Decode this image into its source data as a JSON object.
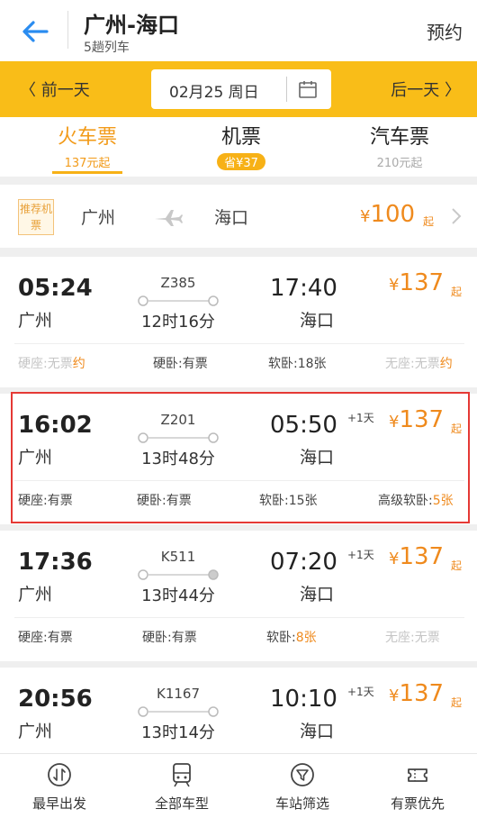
{
  "header": {
    "title": "广州-海口",
    "subtitle": "5趟列车",
    "reserve": "预约"
  },
  "datebar": {
    "prev": "前一天",
    "date": "02月25 周日",
    "next": "后一天"
  },
  "tabs": [
    {
      "label": "火车票",
      "sub": "137元起"
    },
    {
      "label": "机票",
      "sub": "省¥37"
    },
    {
      "label": "汽车票",
      "sub": "210元起"
    }
  ],
  "flight": {
    "tag": "推荐机票",
    "from": "广州",
    "to": "海口",
    "price_symbol": "¥",
    "price": "100",
    "qi": "起"
  },
  "trains": [
    {
      "dep_time": "05:24",
      "dep_station": "广州",
      "number": "Z385",
      "duration": "12时16分",
      "arr_time": "17:40",
      "arr_station": "海口",
      "plus_day": "",
      "price_symbol": "¥",
      "price": "137",
      "qi": "起",
      "seats": [
        {
          "label": "硬座:",
          "value": "无票",
          "extra": "约"
        },
        {
          "label": "硬卧:",
          "value": "有票",
          "extra": ""
        },
        {
          "label": "软卧:",
          "value": "18张",
          "extra": ""
        },
        {
          "label": "无座:",
          "value": "无票",
          "extra": "约"
        }
      ]
    },
    {
      "dep_time": "16:02",
      "dep_station": "广州",
      "number": "Z201",
      "duration": "13时48分",
      "arr_time": "05:50",
      "arr_station": "海口",
      "plus_day": "+1天",
      "price_symbol": "¥",
      "price": "137",
      "qi": "起",
      "seats": [
        {
          "label": "硬座:",
          "value": "有票",
          "extra": ""
        },
        {
          "label": "硬卧:",
          "value": "有票",
          "extra": ""
        },
        {
          "label": "软卧:",
          "value": "15张",
          "extra": ""
        },
        {
          "label": "高级软卧:",
          "value": "5张",
          "extra": ""
        }
      ]
    },
    {
      "dep_time": "17:36",
      "dep_station": "广州",
      "number": "K511",
      "duration": "13时44分",
      "arr_time": "07:20",
      "arr_station": "海口",
      "plus_day": "+1天",
      "price_symbol": "¥",
      "price": "137",
      "qi": "起",
      "seats": [
        {
          "label": "硬座:",
          "value": "有票",
          "extra": ""
        },
        {
          "label": "硬卧:",
          "value": "有票",
          "extra": ""
        },
        {
          "label": "软卧:",
          "value": "8张",
          "extra": ""
        },
        {
          "label": "无座:",
          "value": "无票",
          "extra": ""
        }
      ]
    },
    {
      "dep_time": "20:56",
      "dep_station": "广州",
      "number": "K1167",
      "duration": "13时14分",
      "arr_time": "10:10",
      "arr_station": "海口",
      "plus_day": "+1天",
      "price_symbol": "¥",
      "price": "137",
      "qi": "起"
    }
  ],
  "bottombar": [
    {
      "label": "最早出发"
    },
    {
      "label": "全部车型"
    },
    {
      "label": "车站筛选"
    },
    {
      "label": "有票优先"
    }
  ],
  "colors": {
    "accent": "#f9bd18",
    "price": "#ef8a1d",
    "back": "#2a8cf0",
    "highlight": "#e53935"
  },
  "icons": {
    "back": "arrow-left-icon",
    "calendar": "calendar-icon",
    "plane": "airplane-icon",
    "chevron": "chevron-right-icon",
    "sort": "clock-sort-icon",
    "train": "train-icon",
    "filter": "funnel-icon",
    "ticket": "ticket-icon"
  }
}
